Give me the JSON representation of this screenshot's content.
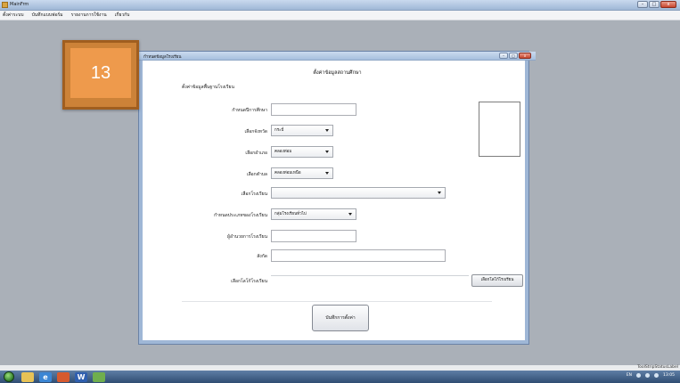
{
  "app": {
    "title": "MainFrm",
    "window_controls": {
      "minimize": "–",
      "maximize": "□",
      "close": "x"
    }
  },
  "menu": [
    "ตั้งค่าระบบ",
    "บันทึกแบบฟอร์ม",
    "รายงานการใช้งาน",
    "เกี่ยวกับ"
  ],
  "badge": {
    "number": "13"
  },
  "dialog": {
    "title": "กำหนดข้อมูลโรงเรียน",
    "heading": "ตั้งค่าข้อมูลสถานศึกษา",
    "group_label": "ตั้งค่าข้อมูลพื้นฐานโรงเรียน",
    "fields": {
      "school_code": {
        "label": "กำหนดปีการศึกษา",
        "value": ""
      },
      "province": {
        "label": "เลือกจังหวัด",
        "value": "กระบี่"
      },
      "district": {
        "label": "เลือกอำเภอ",
        "value": "คลองท่อม"
      },
      "subdistrict": {
        "label": "เลือกตำบล",
        "value": "คลองท่อมเหนือ"
      },
      "school": {
        "label": "เลือกโรงเรียน",
        "value": ""
      },
      "school_type": {
        "label": "กำหนดประเภทของโรงเรียน",
        "value": "กลุ่มโรงเรียนทั่วไป"
      },
      "director": {
        "label": "ผู้อำนวยการโรงเรียน",
        "value": ""
      },
      "affiliation": {
        "label": "สังกัด",
        "value": ""
      },
      "logo": {
        "label": "เลือกโลโก้โรงเรียน",
        "button": "เลือกโลโก้โรงเรียน"
      }
    },
    "save_button": "บันทึกการตั้งค่า"
  },
  "status": {
    "label": "ToolStripStatusLabel"
  },
  "taskbar": {
    "language": "EN",
    "clock": "13:05"
  },
  "colors": {
    "workspace": "#aab0b8",
    "badge_outer": "#cc8238",
    "badge_inner": "#ee9a4c",
    "taskbar": "#2f4d72"
  }
}
